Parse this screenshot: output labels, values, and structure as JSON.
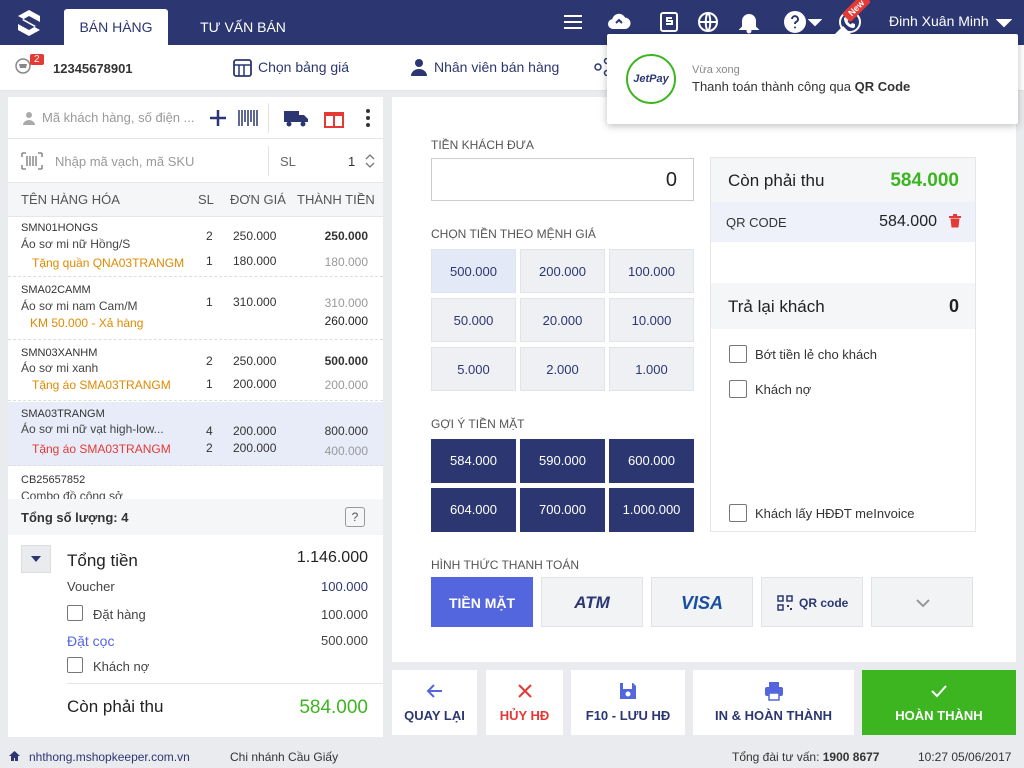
{
  "header": {
    "tabs": [
      "BÁN HÀNG",
      "TƯ VẤN BÁN HÀNG"
    ],
    "new_badge": "New",
    "username": "Đinh Xuân Minh",
    "icons": [
      "menu-icon",
      "cloud-sync-icon",
      "shop-icon",
      "globe-icon",
      "bell-icon",
      "help-icon",
      "phone-icon"
    ]
  },
  "subbar": {
    "cart_count": "2",
    "order_number": "12345678901",
    "price_list": "Chọn bảng giá",
    "sales_staff": "Nhân viên bán hàng"
  },
  "notification": {
    "logo_text": "JetPay",
    "time": "Vừa xong",
    "message_prefix": "Thanh toán thành công qua ",
    "message_bold": "QR Code"
  },
  "left": {
    "customer_placeholder": "Mã khách hàng, số điện ...",
    "barcode_placeholder": "Nhập mã vạch, mã SKU",
    "qty_label": "SL",
    "qty_value": "1",
    "columns": {
      "name": "TÊN HÀNG HÓA",
      "qty": "SL",
      "price": "ĐƠN GIÁ",
      "total": "THÀNH TIỀN"
    },
    "items": [
      {
        "code": "SMN01HONGS",
        "name": "Áo sơ mi nữ Hồng/S",
        "qty": "2",
        "price": "250.000",
        "total": "250.000",
        "promo": "Tặng quần QNA03TRANGM",
        "promo_qty": "1",
        "promo_price": "180.000",
        "promo_total": "180.000"
      },
      {
        "code": "SMA02CAMM",
        "name": "Áo sơ mi nam Cam/M",
        "qty": "1",
        "price": "310.000",
        "total": "310.000",
        "promo": "KM 50.000 - Xả hàng",
        "promo_total": "260.000"
      },
      {
        "code": "SMN03XANHM",
        "name": "Áo sơ mi xanh",
        "qty": "2",
        "price": "250.000",
        "total": "500.000",
        "promo": "Tặng áo SMA03TRANGM",
        "promo_qty": "1",
        "promo_price": "200.000",
        "promo_total": "200.000"
      },
      {
        "code": "SMA03TRANGM",
        "name": "Áo sơ mi nữ vạt high-low...",
        "qty": "4",
        "price": "200.000",
        "total": "800.000",
        "promo": "Tặng áo SMA03TRANGM",
        "promo_qty": "2",
        "promo_price": "200.000",
        "promo_total": "400.000"
      },
      {
        "code": "CB25657852",
        "name": "Combo đồ công sở"
      }
    ],
    "total_qty_label": "Tổng số lượng: 4",
    "total_label": "Tổng tiền",
    "total_value": "1.146.000",
    "voucher_label": "Voucher",
    "voucher_value": "100.000",
    "order_label": "Đặt hàng",
    "order_value": "100.000",
    "deposit_label": "Đặt cọc",
    "deposit_value": "500.000",
    "debt_label": "Khách nợ",
    "remaining_label": "Còn phải thu",
    "remaining_value": "584.000"
  },
  "payment": {
    "cash_label": "TIỀN KHÁCH ĐƯA",
    "cash_value": "0",
    "denom_label": "CHỌN TIỀN THEO MỆNH GIÁ",
    "denoms": [
      "500.000",
      "200.000",
      "100.000",
      "50.000",
      "20.000",
      "10.000",
      "5.000",
      "2.000",
      "1.000"
    ],
    "suggest_label": "GỢI Ý TIỀN MẶT",
    "suggestions": [
      "584.000",
      "590.000",
      "600.000",
      "604.000",
      "700.000",
      "1.000.000"
    ],
    "method_label": "HÌNH THỨC THANH TOÁN",
    "methods": [
      "TIỀN MẶT",
      "ATM",
      "VISA",
      "QR code"
    ]
  },
  "summary": {
    "due_label": "Còn phải thu",
    "due_value": "584.000",
    "qr_label": "QR CODE",
    "qr_value": "584.000",
    "change_label": "Trả lại khách",
    "change_value": "0",
    "round_label": "Bớt tiền lẻ cho khách",
    "debt_label": "Khách nợ",
    "invoice_label": "Khách lấy HĐĐT meInvoice"
  },
  "actions": {
    "back": "QUAY LẠI",
    "cancel": "HỦY HĐ",
    "save": "F10 - LƯU HĐ",
    "print": "IN & HOÀN THÀNH",
    "finish": "HOÀN THÀNH"
  },
  "footer": {
    "website": "nhthong.mshopkeeper.com.vn",
    "branch": "Chi nhánh Cầu Giấy",
    "hotline_label": "Tổng đài tư vấn: ",
    "hotline": "1900 8677",
    "datetime": "10:27 05/06/2017"
  },
  "colors": {
    "navy": "#2c3772",
    "green": "#3cb521",
    "red": "#e53935",
    "accent": "#5466dd"
  }
}
